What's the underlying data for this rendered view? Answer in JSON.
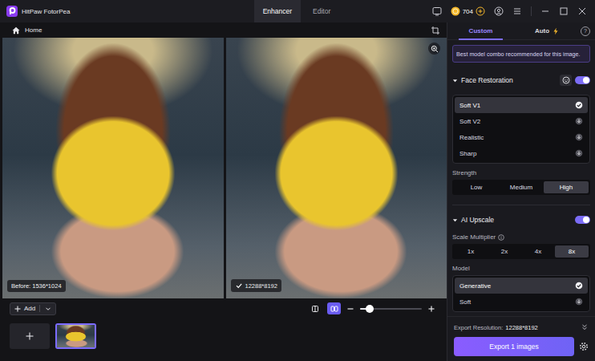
{
  "window": {
    "app_name": "HitPaw FotorPea"
  },
  "mode_tabs": [
    {
      "label": "Enhancer",
      "selected": true
    },
    {
      "label": "Editor",
      "selected": false
    }
  ],
  "title_bar": {
    "coins": "704"
  },
  "breadcrumb": {
    "label": "Home"
  },
  "preview": {
    "before": {
      "label": "Before: 1536*1024"
    },
    "after": {
      "label": "12288*8192",
      "done": true
    }
  },
  "toolbar": {
    "add_label": "Add",
    "compare_modes": [
      {
        "kind": "single",
        "selected": false
      },
      {
        "kind": "split",
        "selected": true
      }
    ],
    "zoom": {
      "level": 0.15
    }
  },
  "thumbnails": [
    {
      "selected": true
    }
  ],
  "panel_tabs": [
    {
      "label": "Custom",
      "selected": true,
      "bolt": false
    },
    {
      "label": "Auto",
      "selected": false,
      "bolt": true
    }
  ],
  "help": "?",
  "banner": "Best model combo recommended for this image.",
  "sections": [
    {
      "title": "Face Restoration",
      "expanded": true,
      "on": true,
      "face_button": true,
      "controls": [
        {
          "kind": "models",
          "options": [
            {
              "name": "Soft V1",
              "selected": true
            },
            {
              "name": "Soft V2",
              "selected": false
            },
            {
              "name": "Realistic",
              "selected": false
            },
            {
              "name": "Sharp",
              "selected": false
            }
          ]
        },
        {
          "kind": "segments",
          "label": "Strength",
          "info": false,
          "options": [
            {
              "label": "Low",
              "selected": false
            },
            {
              "label": "Medium",
              "selected": false
            },
            {
              "label": "High",
              "selected": true
            }
          ]
        }
      ]
    },
    {
      "title": "AI Upscale",
      "expanded": true,
      "on": true,
      "face_button": false,
      "controls": [
        {
          "kind": "segments",
          "label": "Scale Multiplier",
          "info": true,
          "options": [
            {
              "label": "1x",
              "selected": false
            },
            {
              "label": "2x",
              "selected": false
            },
            {
              "label": "4x",
              "selected": false
            },
            {
              "label": "8x",
              "selected": true
            }
          ]
        },
        {
          "kind": "models",
          "label": "Model",
          "options": [
            {
              "name": "Generative",
              "selected": true
            },
            {
              "name": "Soft",
              "selected": false
            }
          ]
        }
      ]
    }
  ],
  "export": {
    "resolution_label": "Export Resolution:",
    "resolution": "12288*8192",
    "button": "Export 1 images"
  }
}
